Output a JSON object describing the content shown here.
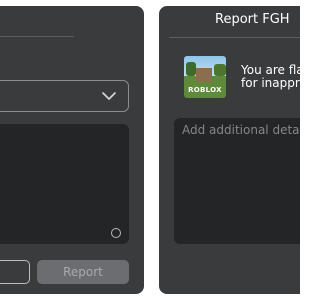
{
  "right_panel": {
    "title": "Report FGH",
    "notice_lines": [
      "You are fla",
      "for inappro"
    ],
    "thumbnail_logo": "ROBLOX",
    "details_placeholder": "Add additional detail"
  },
  "left_panel": {
    "submit_label": "Report"
  },
  "colors": {
    "panel_bg": "#393b3d",
    "textarea_bg": "#232527",
    "disabled_button_bg": "#6b6d70"
  },
  "icons": [
    "chevron-down-icon",
    "character-counter-icon"
  ]
}
